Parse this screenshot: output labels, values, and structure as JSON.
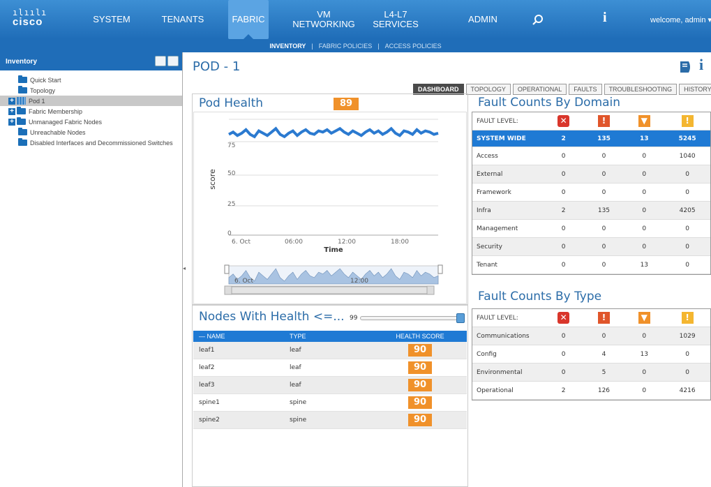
{
  "colors": {
    "nav_bg": "#1f6db8",
    "accent": "#2b6ca8",
    "health_orange": "#f0912a",
    "critical": "#d9362b",
    "major": "#e0552a",
    "minor": "#f0912a",
    "warning": "#f4b630"
  },
  "topnav": {
    "brand": "cisco",
    "items": [
      "SYSTEM",
      "TENANTS",
      "FABRIC",
      "VM NETWORKING",
      "L4-L7 SERVICES",
      "ADMIN"
    ],
    "active": "FABRIC",
    "welcome": "welcome, admin ▾"
  },
  "subnav": {
    "items": [
      "INVENTORY",
      "FABRIC POLICIES",
      "ACCESS POLICIES"
    ],
    "active": "INVENTORY"
  },
  "sidebar": {
    "title": "Inventory",
    "items": [
      {
        "label": "Quick Start"
      },
      {
        "label": "Topology"
      },
      {
        "label": "Pod 1"
      },
      {
        "label": "Fabric Membership"
      },
      {
        "label": "Unmanaged Fabric Nodes"
      },
      {
        "label": "Unreachable Nodes"
      },
      {
        "label": "Disabled Interfaces and Decommissioned Switches"
      }
    ]
  },
  "main": {
    "title": "POD - 1",
    "tabs": [
      "DASHBOARD",
      "TOPOLOGY",
      "OPERATIONAL",
      "FAULTS",
      "TROUBLESHOOTING",
      "HISTORY"
    ],
    "active_tab": "DASHBOARD"
  },
  "pod_health": {
    "title": "Pod Health",
    "score": "89",
    "chart": {
      "ylabel": "score",
      "xlabel": "Time",
      "yticks": [
        "0",
        "25",
        "50",
        "75"
      ],
      "xticks": [
        "6. Oct",
        "06:00",
        "12:00",
        "18:00"
      ],
      "navigator_ticks": [
        "6. Oct",
        "12:00"
      ],
      "ylim": [
        0,
        100
      ]
    }
  },
  "chart_data": {
    "type": "line",
    "xlabel": "Time",
    "ylabel": "score",
    "ylim": [
      0,
      100
    ],
    "series": [
      {
        "values": [
          87,
          89,
          86,
          88,
          91,
          87,
          85,
          90,
          88,
          86,
          89,
          92,
          87,
          85,
          88,
          90,
          86,
          89,
          91,
          88,
          87,
          90,
          89,
          91,
          88,
          90,
          92,
          89,
          87,
          90,
          88,
          86,
          89,
          91,
          88,
          90,
          87,
          89,
          92,
          88,
          86,
          90,
          89,
          87,
          91,
          88,
          90,
          89,
          87,
          88
        ]
      }
    ]
  },
  "nodes": {
    "title": "Nodes With Health <=...",
    "threshold": "99",
    "threshold_fraction": 0.99,
    "columns": [
      "— NAME",
      "TYPE",
      "HEALTH SCORE"
    ],
    "rows": [
      {
        "name": "leaf1",
        "type": "leaf",
        "score": "90"
      },
      {
        "name": "leaf2",
        "type": "leaf",
        "score": "90"
      },
      {
        "name": "leaf3",
        "type": "leaf",
        "score": "90"
      },
      {
        "name": "spine1",
        "type": "spine",
        "score": "90"
      },
      {
        "name": "spine2",
        "type": "spine",
        "score": "90"
      }
    ]
  },
  "fault_domain": {
    "title": "Fault Counts By Domain",
    "level_label": "FAULT LEVEL:",
    "rows": [
      {
        "name": "SYSTEM WIDE",
        "c": [
          "2",
          "135",
          "13",
          "5245"
        ]
      },
      {
        "name": "Access",
        "c": [
          "0",
          "0",
          "0",
          "1040"
        ]
      },
      {
        "name": "External",
        "c": [
          "0",
          "0",
          "0",
          "0"
        ]
      },
      {
        "name": "Framework",
        "c": [
          "0",
          "0",
          "0",
          "0"
        ]
      },
      {
        "name": "Infra",
        "c": [
          "2",
          "135",
          "0",
          "4205"
        ]
      },
      {
        "name": "Management",
        "c": [
          "0",
          "0",
          "0",
          "0"
        ]
      },
      {
        "name": "Security",
        "c": [
          "0",
          "0",
          "0",
          "0"
        ]
      },
      {
        "name": "Tenant",
        "c": [
          "0",
          "0",
          "13",
          "0"
        ]
      }
    ]
  },
  "fault_type": {
    "title": "Fault Counts By Type",
    "level_label": "FAULT LEVEL:",
    "rows": [
      {
        "name": "Communications",
        "c": [
          "0",
          "0",
          "0",
          "1029"
        ]
      },
      {
        "name": "Config",
        "c": [
          "0",
          "4",
          "13",
          "0"
        ]
      },
      {
        "name": "Environmental",
        "c": [
          "0",
          "5",
          "0",
          "0"
        ]
      },
      {
        "name": "Operational",
        "c": [
          "2",
          "126",
          "0",
          "4216"
        ]
      }
    ]
  }
}
